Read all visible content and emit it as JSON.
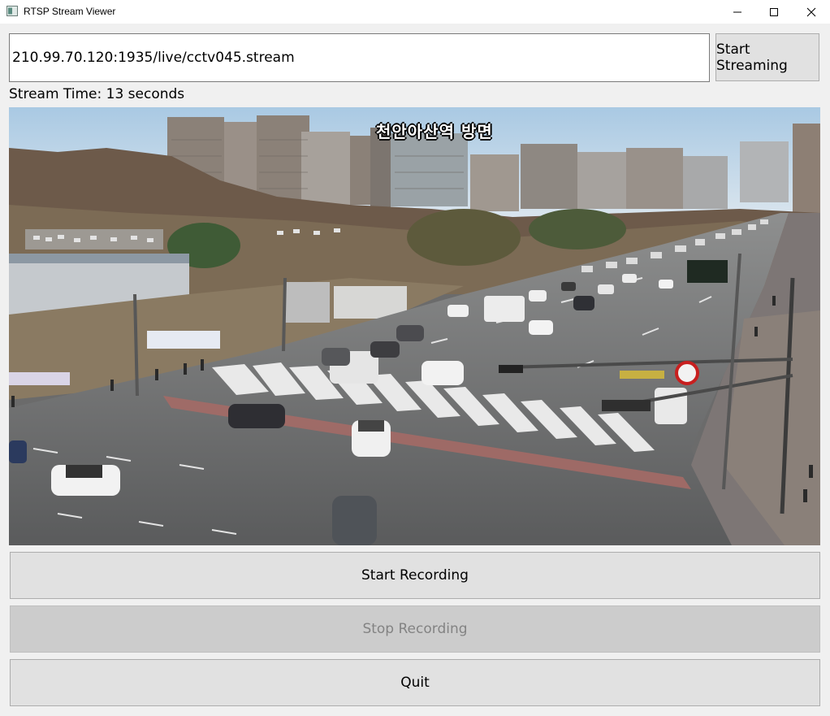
{
  "window": {
    "title": "RTSP Stream Viewer"
  },
  "stream": {
    "url": "210.99.70.120:1935/live/cctv045.stream",
    "start_label": "Start Streaming",
    "time_label": "Stream Time: 13 seconds"
  },
  "video": {
    "overlay_text": "천안아산역 방면"
  },
  "controls": {
    "start_recording_label": "Start Recording",
    "stop_recording_label": "Stop Recording",
    "quit_label": "Quit"
  },
  "icons": {
    "app": "app-window-icon",
    "minimize": "minimize-icon",
    "maximize": "maximize-icon",
    "close": "close-icon"
  }
}
